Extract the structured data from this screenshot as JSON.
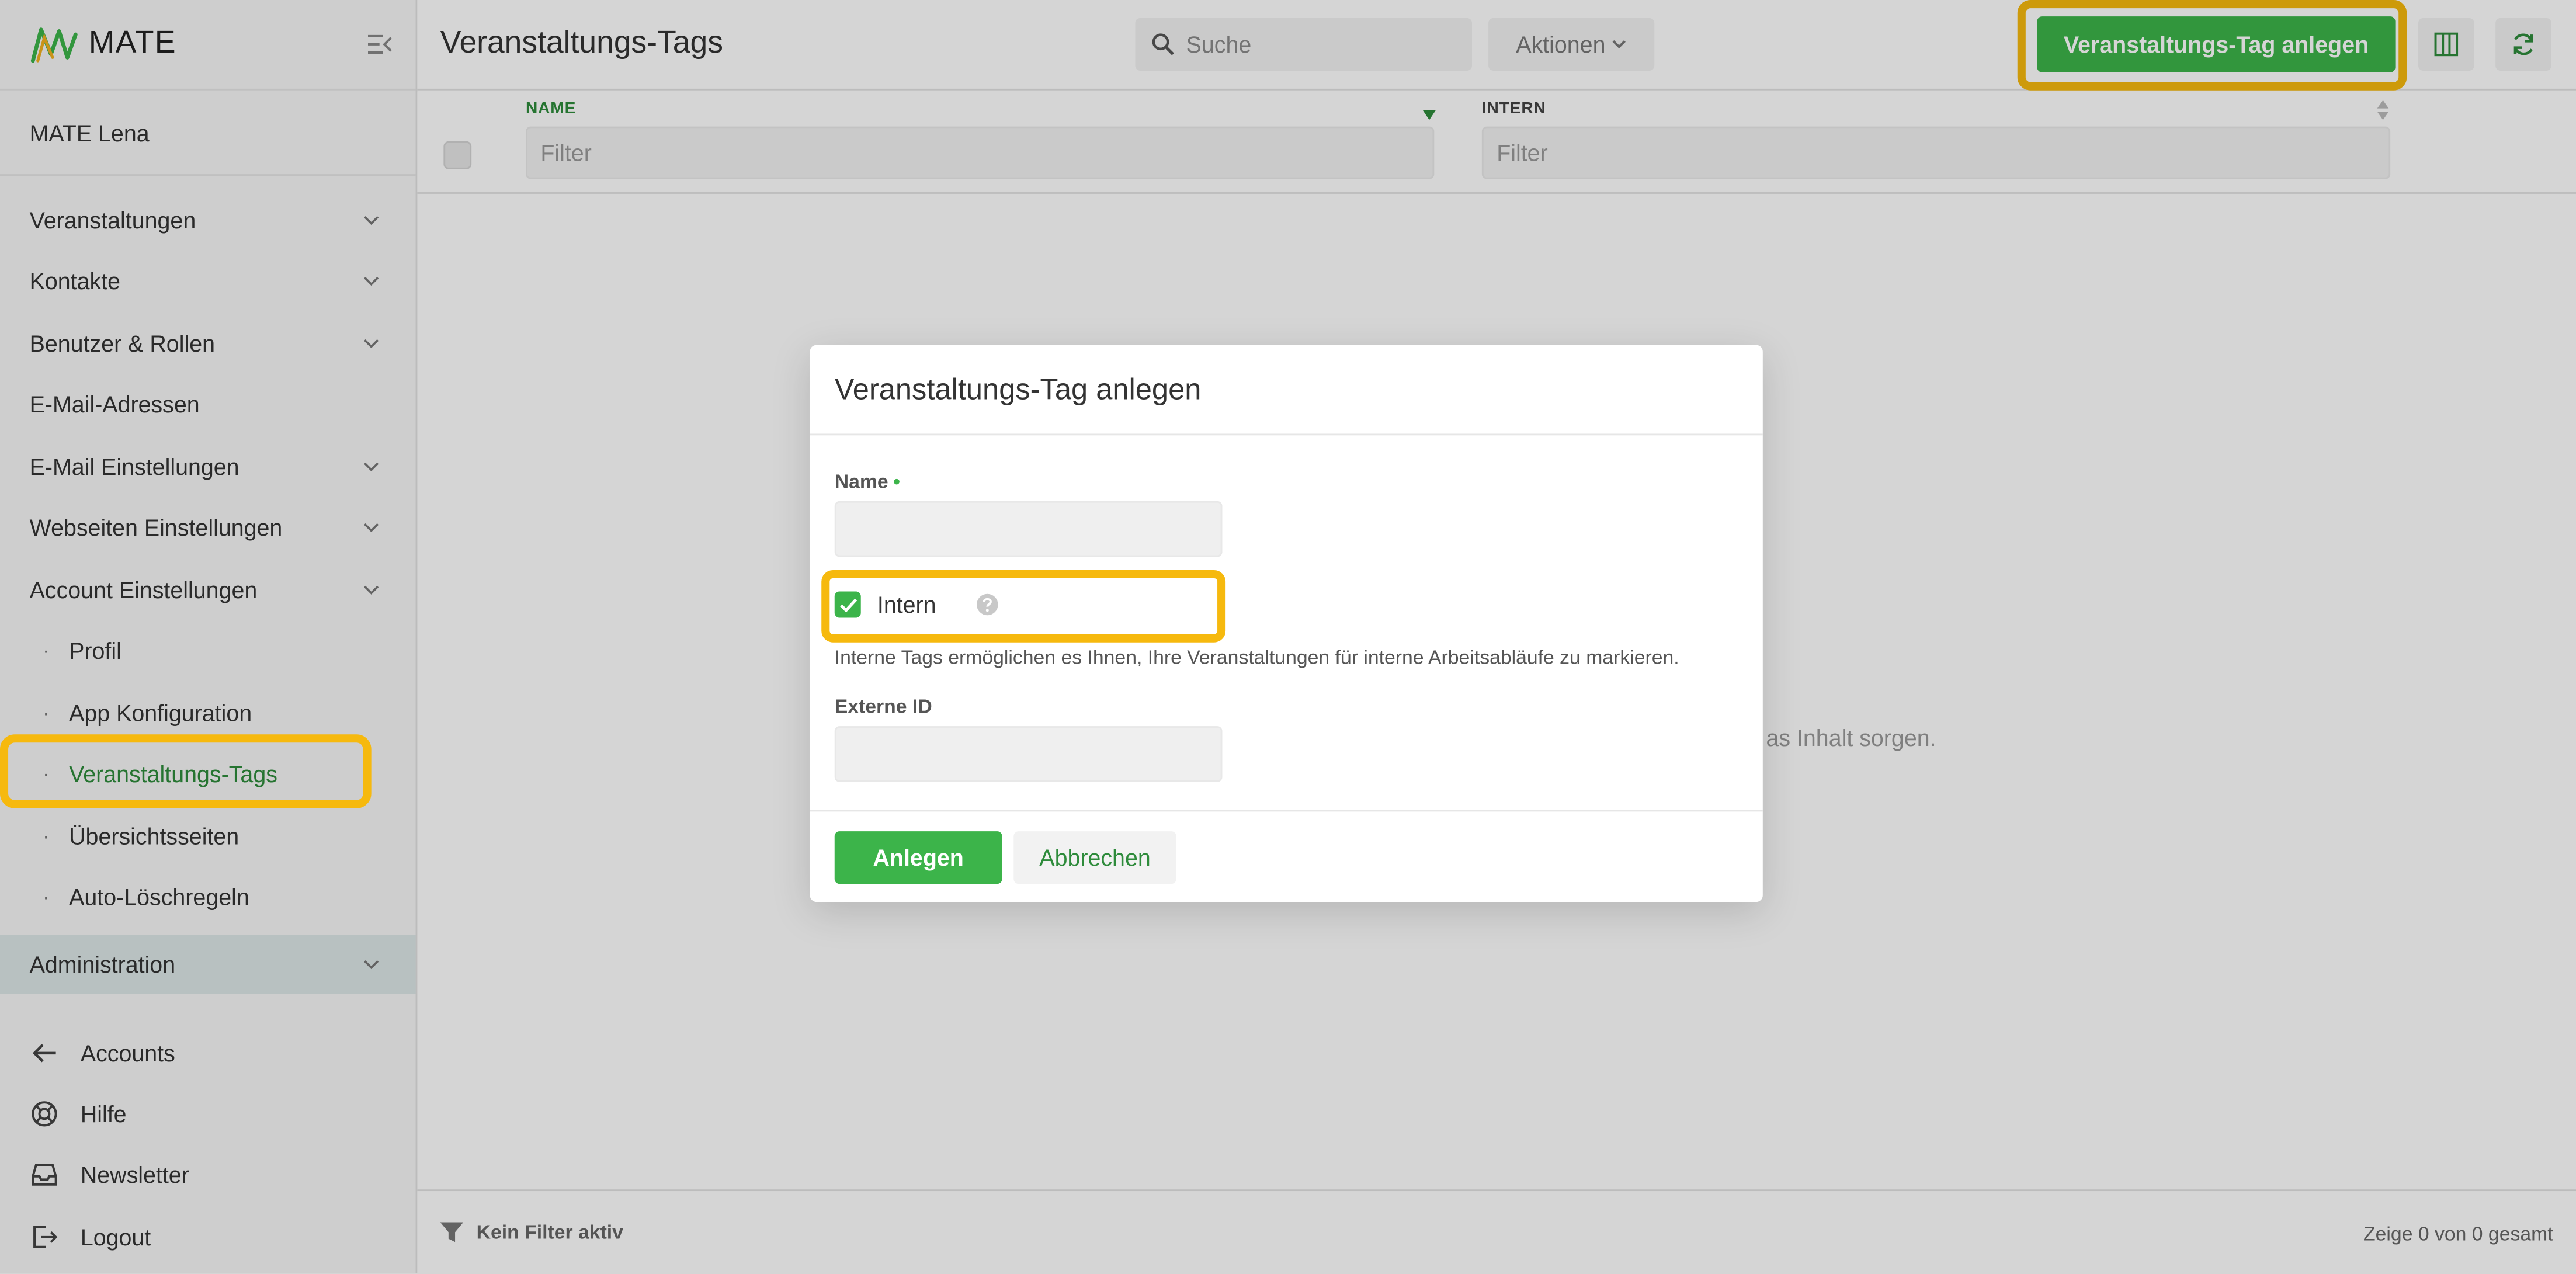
{
  "app": {
    "name": "MATE"
  },
  "sidebar": {
    "account": "MATE Lena",
    "items": [
      {
        "label": "Veranstaltungen"
      },
      {
        "label": "Kontakte"
      },
      {
        "label": "Benutzer & Rollen"
      },
      {
        "label": "E-Mail-Adressen"
      },
      {
        "label": "E-Mail Einstellungen"
      },
      {
        "label": "Webseiten Einstellungen"
      },
      {
        "label": "Account Einstellungen"
      }
    ],
    "sub_items": [
      {
        "label": "Profil"
      },
      {
        "label": "App Konfiguration"
      },
      {
        "label": "Veranstaltungs-Tags"
      },
      {
        "label": "Übersichtsseiten"
      },
      {
        "label": "Auto-Löschregeln"
      }
    ],
    "bullet": "·",
    "admin": "Administration",
    "bottom": [
      {
        "label": "Accounts"
      },
      {
        "label": "Hilfe"
      },
      {
        "label": "Newsletter"
      },
      {
        "label": "Logout"
      }
    ]
  },
  "header": {
    "title": "Veranstaltungs-Tags",
    "search_placeholder": "Suche",
    "actions_label": "Aktionen",
    "create_label": "Veranstaltungs-Tag anlegen"
  },
  "table": {
    "columns": [
      {
        "label": "NAME",
        "filter_placeholder": "Filter"
      },
      {
        "label": "INTERN",
        "filter_placeholder": "Filter"
      }
    ],
    "empty_partial": "as Inhalt sorgen."
  },
  "footer": {
    "filter_status": "Kein Filter aktiv",
    "count": "Zeige 0 von 0 gesamt"
  },
  "modal": {
    "title": "Veranstaltungs-Tag anlegen",
    "name_label": "Name",
    "required_mark": "•",
    "intern_label": "Intern",
    "intern_hint": "Interne Tags ermöglichen es Ihnen, Ihre Veranstaltungen für interne Arbeitsabläufe zu markieren.",
    "external_id_label": "Externe ID",
    "create_button": "Anlegen",
    "cancel_button": "Abbrechen"
  },
  "colors": {
    "accent": "#3cb44a",
    "accent_text": "#2e8b3b",
    "highlight": "#f6b90e"
  },
  "icons": {
    "logo": "mate-logo-icon",
    "collapse": "collapse-sidebar-icon",
    "search": "search-icon",
    "columns": "columns-icon",
    "refresh": "refresh-icon",
    "filter": "funnel-icon",
    "help": "question-icon"
  }
}
